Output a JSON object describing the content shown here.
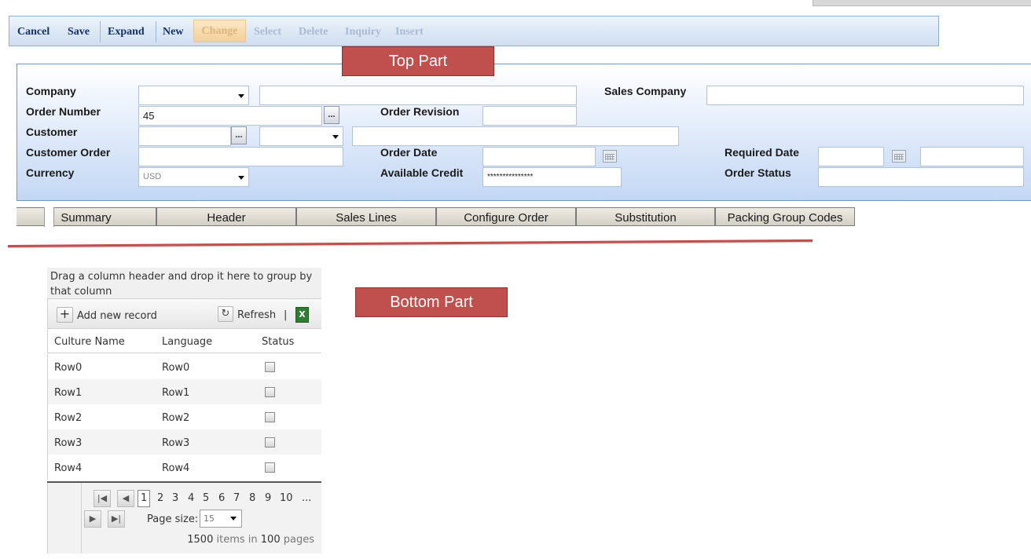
{
  "toolbar": {
    "cancel": "Cancel",
    "save": "Save",
    "expand": "Expand",
    "new": "New",
    "change": "Change",
    "select": "Select",
    "delete": "Delete",
    "inquiry": "Inquiry",
    "insert": "Insert"
  },
  "annotations": {
    "top": "Top Part",
    "bottom": "Bottom Part"
  },
  "form": {
    "company_label": "Company",
    "company_value": "",
    "sales_company_label": "Sales Company",
    "order_number_label": "Order Number",
    "order_number_value": "45",
    "order_revision_label": "Order Revision",
    "customer_label": "Customer",
    "customer_order_label": "Customer Order",
    "order_date_label": "Order Date",
    "required_date_label": "Required Date",
    "currency_label": "Currency",
    "currency_value": "USD",
    "available_credit_label": "Available Credit",
    "available_credit_value": "***************",
    "order_status_label": "Order Status",
    "ellipsis": "..."
  },
  "tabs": [
    "Summary",
    "Header",
    "Sales Lines",
    "Configure Order",
    "Substitution",
    "Packing Group Codes"
  ],
  "grid": {
    "group_hint": "Drag a column header and drop it here to group by that column",
    "add_label": "Add new record",
    "refresh_label": "Refresh",
    "separator": "|",
    "columns": [
      "Culture Name",
      "Language",
      "Status"
    ],
    "rows": [
      {
        "culture": "Row0",
        "language": "Row0"
      },
      {
        "culture": "Row1",
        "language": "Row1"
      },
      {
        "culture": "Row2",
        "language": "Row2"
      },
      {
        "culture": "Row3",
        "language": "Row3"
      },
      {
        "culture": "Row4",
        "language": "Row4"
      }
    ],
    "pager": {
      "pages": [
        "1",
        "2",
        "3",
        "4",
        "5",
        "6",
        "7",
        "8",
        "9",
        "10",
        "..."
      ],
      "page_size_label": "Page size:",
      "page_size_value": "15",
      "items_count": "1500",
      "items_text": "items in",
      "pages_count": "100",
      "pages_text": "pages"
    }
  }
}
